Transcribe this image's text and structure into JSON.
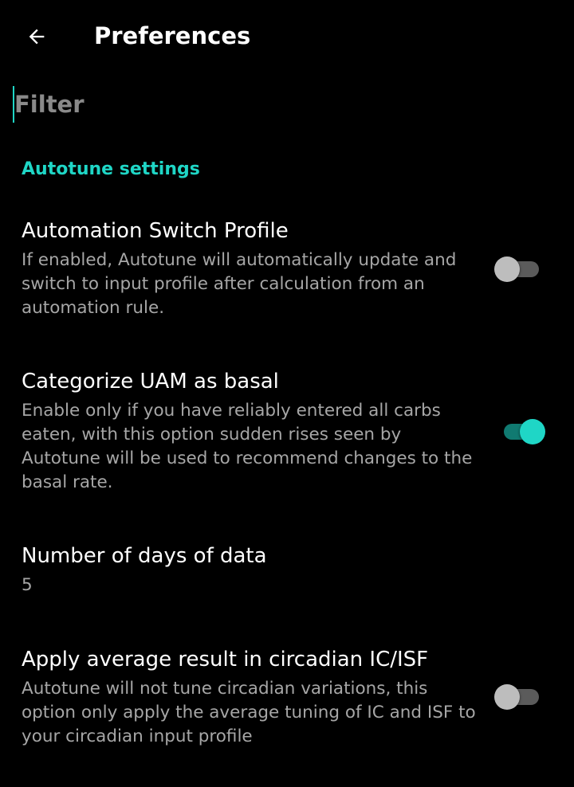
{
  "appbar": {
    "title": "Preferences",
    "back_icon": "arrow-left-icon"
  },
  "filter": {
    "placeholder": "Filter",
    "value": ""
  },
  "category": {
    "title": "Autotune settings"
  },
  "preferences": [
    {
      "title": "Automation Switch Profile",
      "summary": "If enabled, Autotune will automatically update and switch to input profile after calculation from an automation rule.",
      "type": "switch",
      "checked": false
    },
    {
      "title": "Categorize UAM as basal",
      "summary": "Enable only if you have reliably entered all carbs eaten, with this option sudden rises seen by Autotune will be used to recommend changes to the basal rate.",
      "type": "switch",
      "checked": true
    },
    {
      "title": "Number of days of data",
      "summary": "5",
      "type": "edit_text"
    },
    {
      "title": "Apply average result in circadian IC/ISF",
      "summary": "Autotune will not tune circadian variations, this option only apply the average tuning of IC and ISF to your circadian input profile",
      "type": "switch",
      "checked": false
    }
  ],
  "colors": {
    "background": "#000000",
    "accent": "#1fd6c6",
    "text_primary": "#ffffff",
    "text_secondary": "#a6a6a6",
    "switch_off_track": "#5b5b5b",
    "switch_off_thumb": "#bdbdbd"
  }
}
